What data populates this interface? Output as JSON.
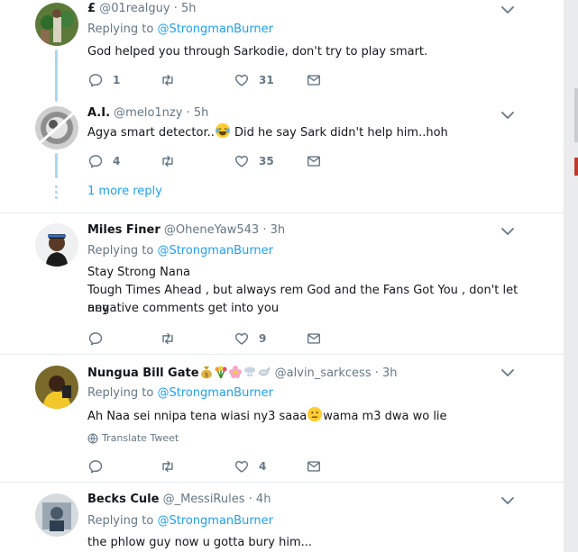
{
  "tweets": [
    {
      "name": "£",
      "handle": "@01realguy",
      "time": "· 5h",
      "replying_prefix": "Replying to",
      "replying_to": "@StrongmanBurner",
      "text": "God helped you through Sarkodie, don't try to play smart.",
      "replies": "1",
      "retweets": "",
      "likes": "31"
    },
    {
      "name": "A.I.",
      "handle": "@melo1nzy",
      "time": "· 5h",
      "text_before": "Agya smart detector..",
      "text_after": " Did he say Sark didn't help him..hoh",
      "replies": "4",
      "retweets": "",
      "likes": "35"
    },
    {
      "more_replies": "1 more reply"
    },
    {
      "name": "Miles Finer",
      "handle": "@OheneYaw543",
      "time": "· 3h",
      "replying_prefix": "Replying to",
      "replying_to": "@StrongmanBurner",
      "line1": "Stay Strong Nana",
      "line2": "Tough Times Ahead , but always rem God and the Fans Got You , don't let any",
      "line3": "negative comments get into you",
      "replies": "",
      "retweets": "",
      "likes": "9"
    },
    {
      "name": "Nungua Bill Gate",
      "handle": "@alvin_sarkcess",
      "time": "· 3h",
      "replying_prefix": "Replying to",
      "replying_to": "@StrongmanBurner",
      "text_before": "Ah Naa sei nnipa tena wiasi ny3 saaa",
      "text_after": "wama m3 dwa wo lie",
      "translate": "Translate Tweet",
      "replies": "",
      "retweets": "",
      "likes": "4"
    },
    {
      "name": "Becks Cule",
      "handle": "@_MessiRules",
      "time": "· 4h",
      "replying_prefix": "Replying to",
      "replying_to": "@StrongmanBurner",
      "text": "the phlow guy now u gotta bury him..."
    }
  ],
  "icons": [
    "reply-icon",
    "retweet-icon",
    "like-icon",
    "dm-icon",
    "chevron-down-icon",
    "globe-icon"
  ],
  "colors": {
    "link": "#1da1f2",
    "muted": "#657786",
    "thread": "#a8d8f0"
  }
}
